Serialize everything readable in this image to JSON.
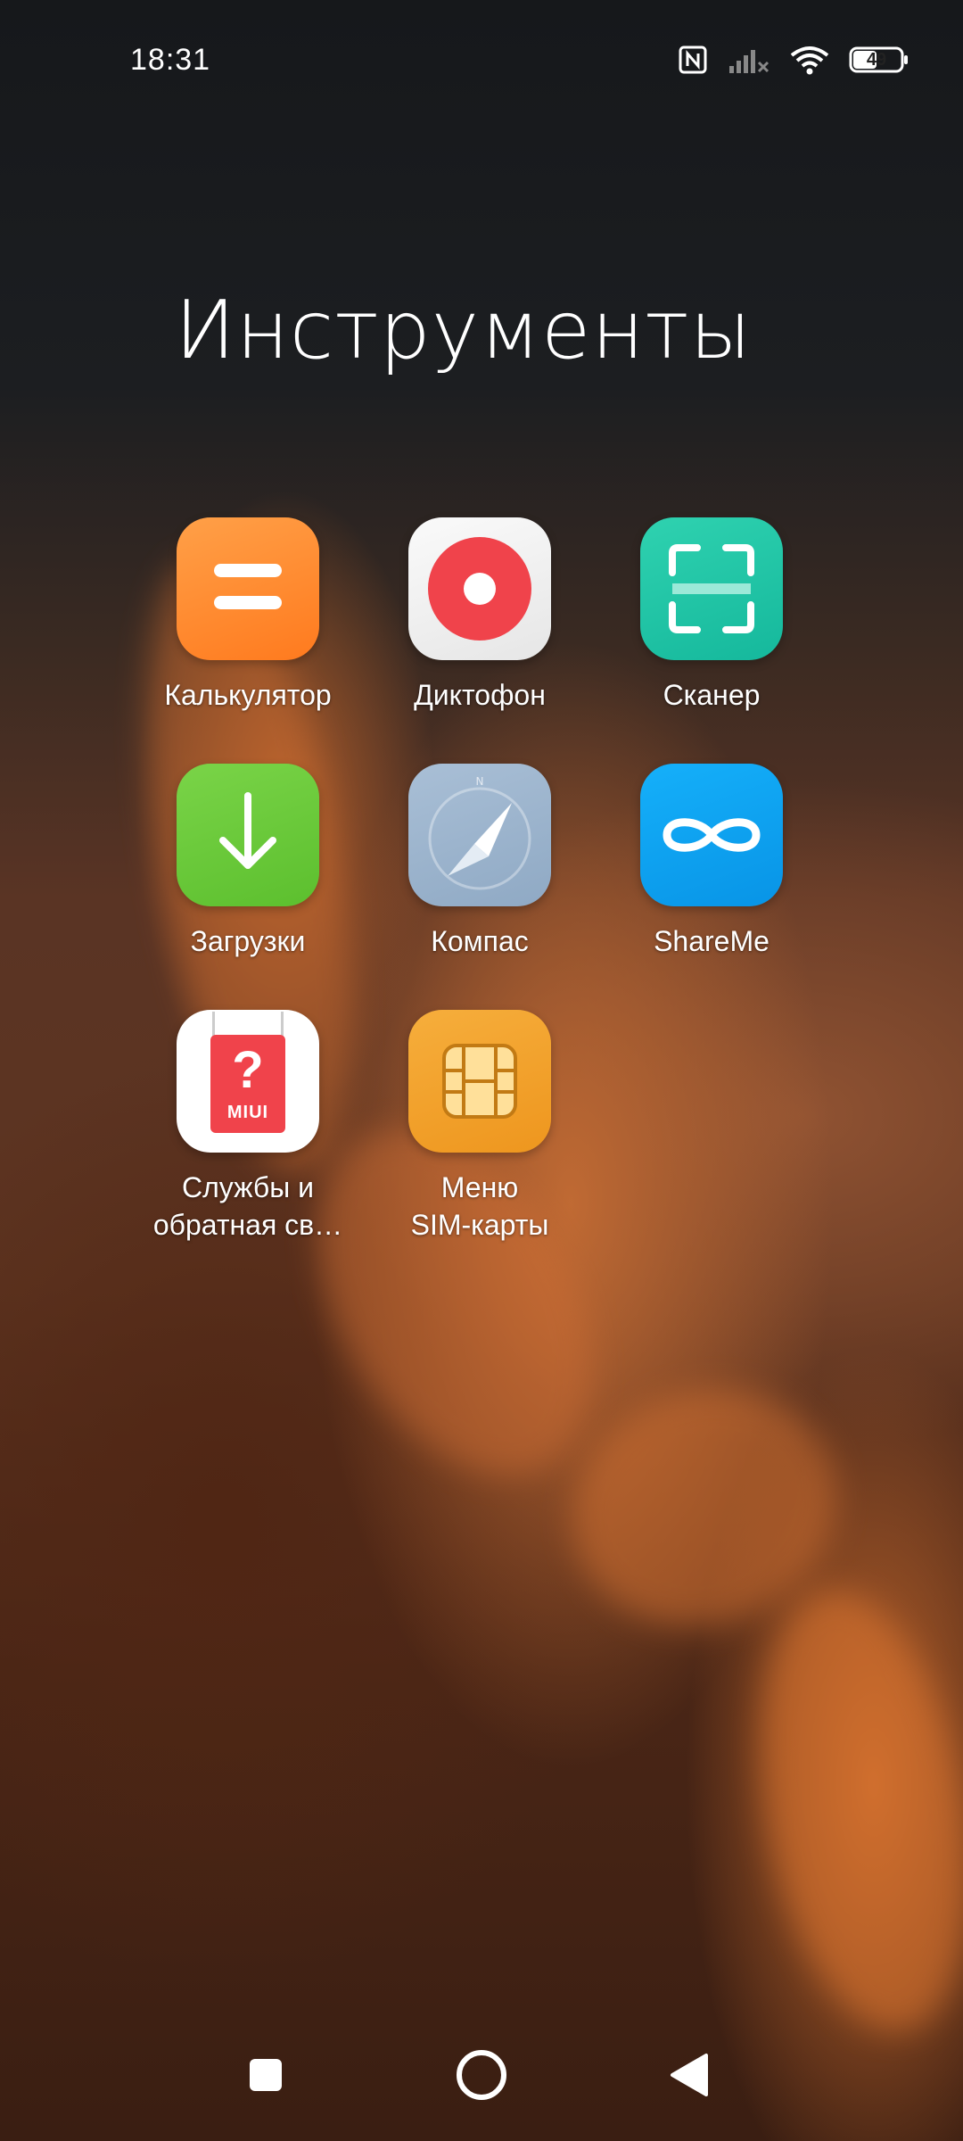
{
  "status_bar": {
    "time": "18:31",
    "battery_level": "49",
    "icons": [
      "nfc-icon",
      "signal-icon",
      "wifi-icon",
      "battery-icon"
    ]
  },
  "folder": {
    "title": "Инструменты",
    "apps": [
      {
        "label": "Калькулятор",
        "icon": "calculator-icon",
        "color": "#FF8A2B"
      },
      {
        "label": "Диктофон",
        "icon": "recorder-icon",
        "color": "#F0434B"
      },
      {
        "label": "Сканер",
        "icon": "scanner-icon",
        "color": "#1FC4A6"
      },
      {
        "label": "Загрузки",
        "icon": "download-icon",
        "color": "#6CC93C"
      },
      {
        "label": "Компас",
        "icon": "compass-icon",
        "color": "#9DB4CC"
      },
      {
        "label": "ShareMe",
        "icon": "shareme-icon",
        "color": "#0AA3F2"
      },
      {
        "label": "Службы и\nобратная св…",
        "icon": "feedback-icon",
        "color": "#F0434B"
      },
      {
        "label": "Меню\nSIM-карты",
        "icon": "sim-card-icon",
        "color": "#F0A02A"
      }
    ],
    "feedback_badge": "MIUI"
  },
  "nav_bar": {
    "buttons": [
      "recents-button",
      "home-button",
      "back-button"
    ]
  }
}
